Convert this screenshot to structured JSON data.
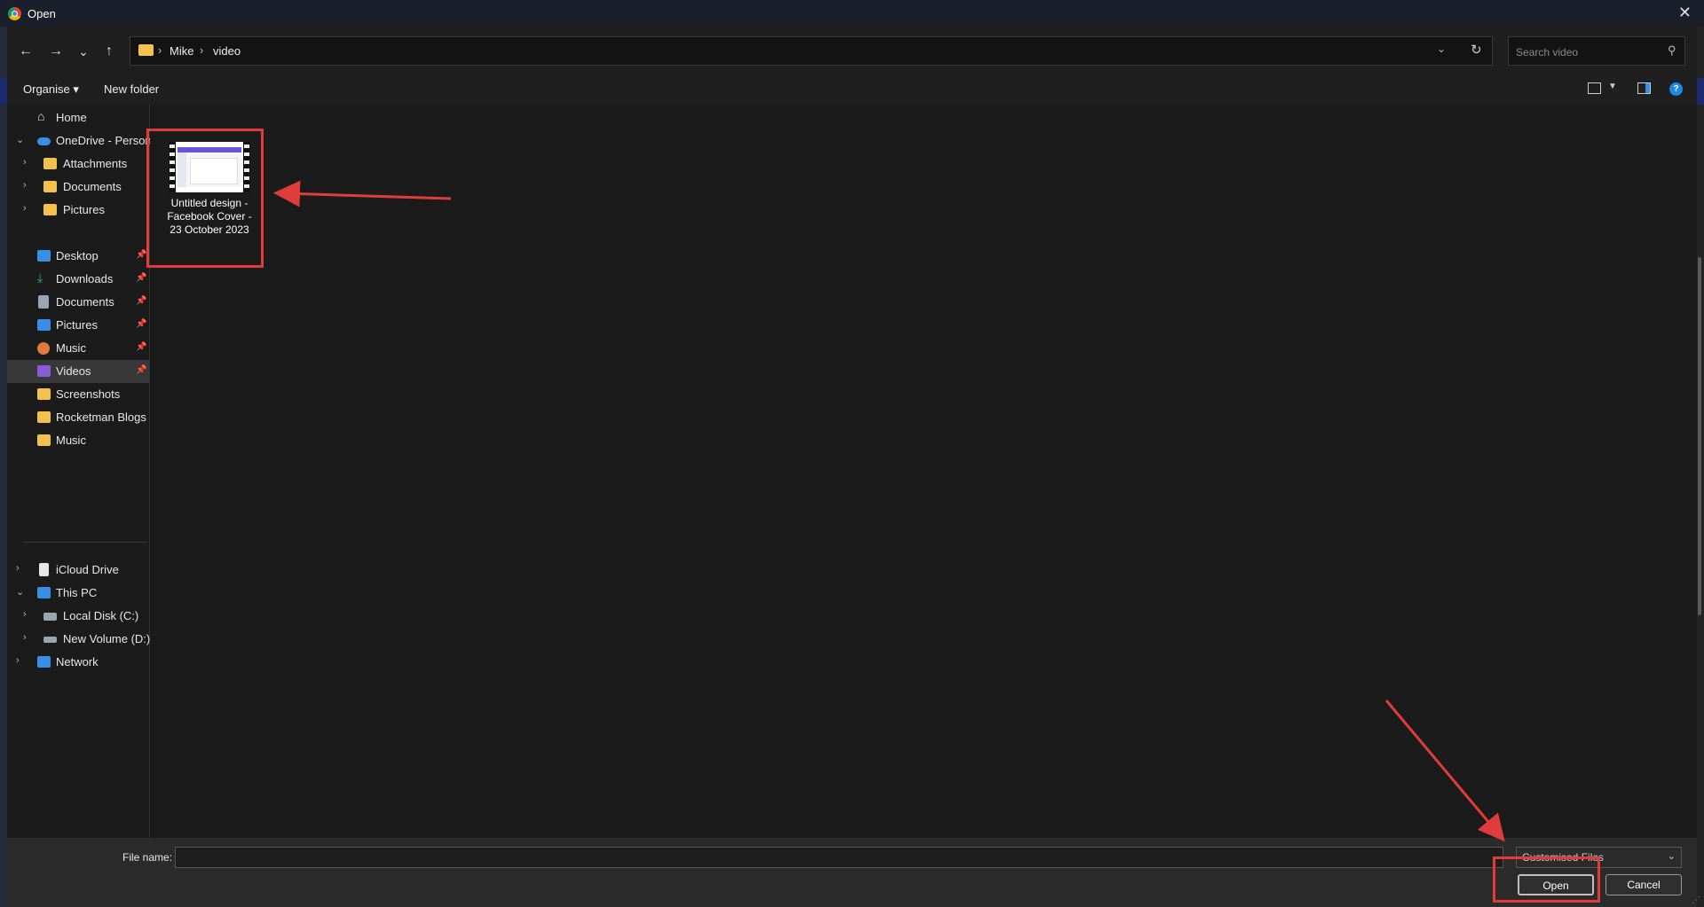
{
  "window": {
    "title": "Open",
    "close_glyph": "✕"
  },
  "address": {
    "crumbs": [
      "Mike",
      "video"
    ],
    "separator": "›",
    "search_placeholder": "Search video"
  },
  "nav_buttons": {
    "back": "←",
    "forward": "→",
    "recent": "⌄",
    "up": "↑"
  },
  "toolbar": {
    "organise": "Organise ▾",
    "new_folder": "New folder"
  },
  "sidebar": {
    "items": [
      {
        "label": "Home",
        "icon": "home-icon",
        "color": "#e7e7e7"
      },
      {
        "label": "OneDrive - Personal",
        "icon": "cloud-icon",
        "color": "#3a8ee6",
        "expanded": true
      },
      {
        "label": "Attachments",
        "icon": "folder-icon",
        "color": "#f2c14e"
      },
      {
        "label": "Documents",
        "icon": "folder-icon",
        "color": "#f2c14e"
      },
      {
        "label": "Pictures",
        "icon": "folder-icon",
        "color": "#f2c14e"
      },
      {
        "label": "Desktop",
        "icon": "desktop-icon",
        "color": "#3a8ee6",
        "pinned": true
      },
      {
        "label": "Downloads",
        "icon": "download-icon",
        "color": "#3cb371",
        "pinned": true
      },
      {
        "label": "Documents",
        "icon": "document-icon",
        "color": "#9aa4b3",
        "pinned": true
      },
      {
        "label": "Pictures",
        "icon": "picture-icon",
        "color": "#3a8ee6",
        "pinned": true
      },
      {
        "label": "Music",
        "icon": "music-icon",
        "color": "#e07a3c",
        "pinned": true
      },
      {
        "label": "Videos",
        "icon": "video-icon",
        "color": "#8a5cd6",
        "pinned": true,
        "selected": true
      },
      {
        "label": "Screenshots",
        "icon": "folder-icon",
        "color": "#f2c14e"
      },
      {
        "label": "Rocketman Blogs",
        "icon": "folder-icon",
        "color": "#f2c14e"
      },
      {
        "label": "Music",
        "icon": "folder-icon",
        "color": "#f2c14e"
      },
      {
        "label": "iCloud Drive",
        "icon": "file-icon",
        "color": "#e6e6e6"
      },
      {
        "label": "This PC",
        "icon": "pc-icon",
        "color": "#3a8ee6",
        "expanded": true
      },
      {
        "label": "Local Disk (C:)",
        "icon": "drive-icon",
        "color": "#9aa4b3"
      },
      {
        "label": "New Volume (D:)",
        "icon": "drive-icon",
        "color": "#9aa4b3"
      },
      {
        "label": "Network",
        "icon": "network-icon",
        "color": "#3a8ee6"
      }
    ]
  },
  "files": [
    {
      "name": "Untitled design - Facebook Cover - 23 October 2023",
      "type": "video"
    }
  ],
  "footer": {
    "file_name_label": "File name:",
    "file_name_value": "",
    "filter_value": "Customised Files",
    "open_label": "Open",
    "cancel_label": "Cancel"
  },
  "colors": {
    "accent": "#e03c3c",
    "selection": "#383838",
    "folder": "#f2c14e",
    "help": "#1e88e5"
  }
}
